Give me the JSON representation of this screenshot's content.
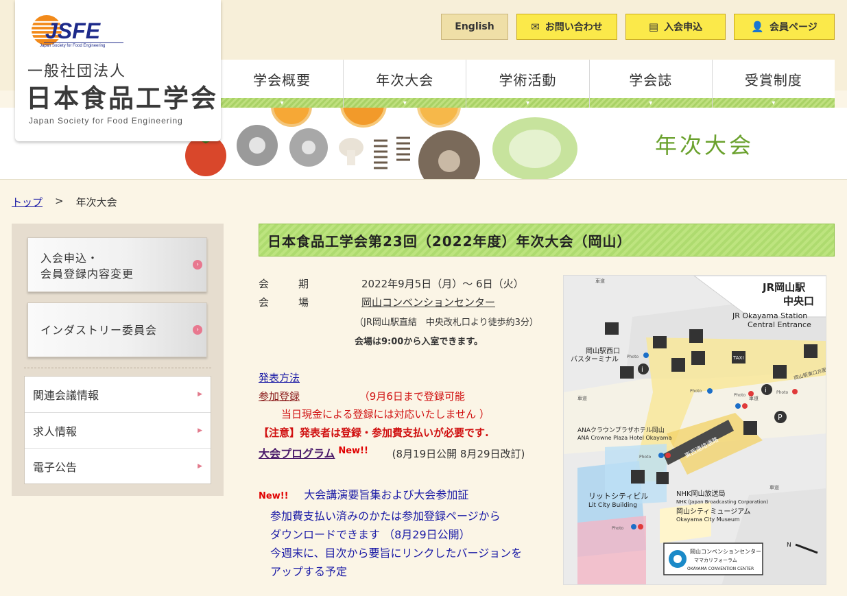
{
  "logo": {
    "emblem": "JSFE",
    "emblem_sub": "Japan Society for Food Engineering",
    "corp_type": "一般社団法人",
    "name_ja": "日本食品工学会",
    "name_en": "Japan Society for Food Engineering"
  },
  "utility_nav": {
    "english": "English",
    "contact": "お問い合わせ",
    "join": "入会申込",
    "member": "会員ページ"
  },
  "global_nav": [
    {
      "label": "学会概要"
    },
    {
      "label": "年次大会"
    },
    {
      "label": "学術活動"
    },
    {
      "label": "学会誌"
    },
    {
      "label": "受賞制度"
    }
  ],
  "hero": {
    "title": "年次大会"
  },
  "breadcrumb": {
    "home": "トップ",
    "separator": ">",
    "current": "年次大会"
  },
  "sidebar": {
    "banners": [
      {
        "line1": "入会申込・",
        "line2": "会員登録内容変更"
      },
      {
        "line1": "インダストリー委員会",
        "line2": ""
      }
    ],
    "links": [
      {
        "label": "関連会議情報"
      },
      {
        "label": "求人情報"
      },
      {
        "label": "電子公告"
      }
    ]
  },
  "main": {
    "title": "日本食品工学会第23回（2022年度）年次大会（岡山）",
    "period_label": "会　期",
    "period_value": "2022年9月5日（月）～ 6日（火）",
    "venue_label": "会　場",
    "venue_link": "岡山コンベンションセンター",
    "venue_note": "（JR岡山駅直結　中央改札口より徒歩約3分）",
    "entry_note": "会場は9:00から入室できます。",
    "presentation_link": "発表方法",
    "registration_link": "参加登録",
    "registration_note1": "（9月6日まで登録可能",
    "registration_note2": "当日現金による登録には対応いたしません ）",
    "caution": "【注意】発表者は登録・参加費支払いが必要です.",
    "program_link": "大会プログラム",
    "new_badge": "New!!",
    "program_note": "(8月19日公開 8月29日改訂)",
    "abstract_title": "大会講演要旨集および大会参加証",
    "abstract_line1": "参加費支払い済みのかたは参加登録ページから",
    "abstract_line2": "ダウンロードできます （8月29日公開）",
    "abstract_line3": "今週末に、目次から要旨にリンクしたバージョンを",
    "abstract_line4": "アップする予定"
  },
  "map": {
    "station_ja": "JR岡山駅",
    "station_exit": "中央口",
    "station_en1": "JR Okayama Station",
    "station_en2": "Central Entrance",
    "bus_terminal1": "岡山駅西口",
    "bus_terminal2": "バスターミナル",
    "hotel_ja": "ANAクラウンプラザホテル岡山",
    "hotel_en": "ANA Crowne Plaza Hotel Okayama",
    "passage": "東西連絡通路",
    "lit_city_ja": "リットシティビル",
    "lit_city_en": "Lit City Building",
    "nhk_ja": "NHK岡山放送局",
    "nhk_en": "NHK (Japan Broadcasting Corporation)",
    "museum_ja": "岡山シティミュージアム",
    "museum_en": "Okayama City Museum",
    "convention_ja": "岡山コンベンションセンター",
    "convention_sub": "ママカリフォーラム",
    "convention_en": "OKAYAMA CONVENTION CENTER",
    "road1": "車道",
    "road2": "車道",
    "road3": "車道",
    "road4": "車道",
    "east_road": "岡山駅東口方面",
    "north": "N",
    "taxi": "TAXI",
    "photo": "Photo",
    "parking": "P",
    "info": "i"
  },
  "colors": {
    "accent_green": "#a9d266",
    "button_yellow": "#fbe94a",
    "link_blue": "#1a1aa6",
    "alert_red": "#d01010"
  }
}
